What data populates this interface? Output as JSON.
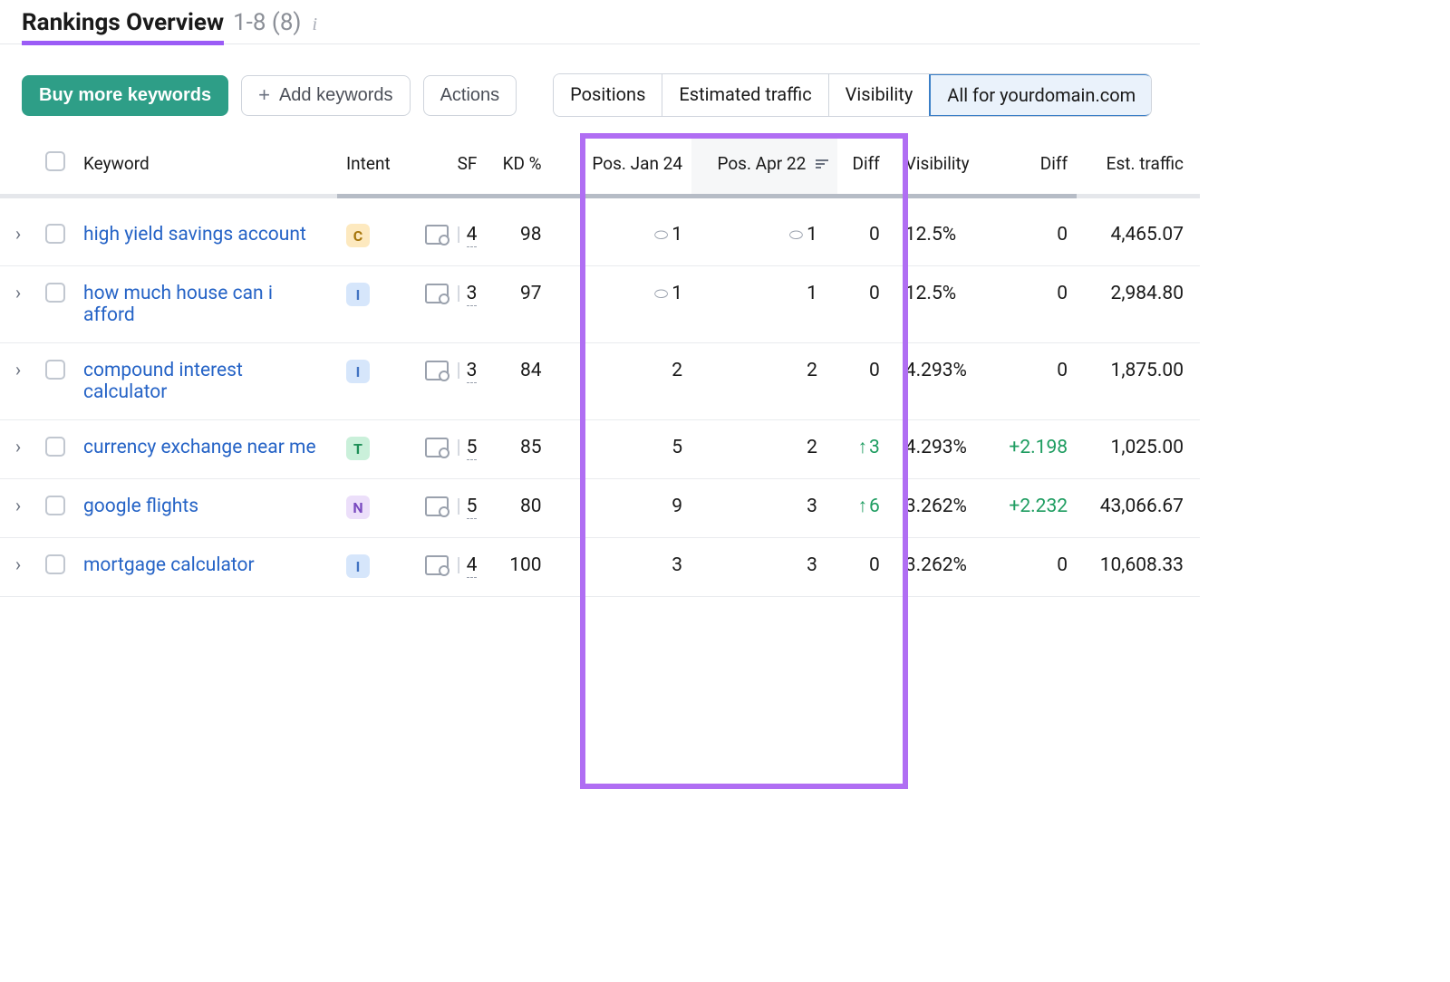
{
  "header": {
    "title": "Rankings Overview",
    "range": "1-8 (8)"
  },
  "toolbar": {
    "buy_label": "Buy more keywords",
    "add_label": "Add keywords",
    "actions_label": "Actions",
    "segs": [
      "Positions",
      "Estimated traffic",
      "Visibility",
      "All for yourdomain.com"
    ],
    "active_seg": 3
  },
  "columns": {
    "keyword": "Keyword",
    "intent": "Intent",
    "sf": "SF",
    "kd": "KD %",
    "pos1": "Pos. Jan 24",
    "pos2": "Pos. Apr 22",
    "diff1": "Diff",
    "visibility": "Visibility",
    "diff2": "Diff",
    "est": "Est. traffic"
  },
  "rows": [
    {
      "keyword": "high yield savings account",
      "intent": "C",
      "sf": "4",
      "kd": "98",
      "pos1": "1",
      "pos1_link": true,
      "pos2": "1",
      "pos2_link": true,
      "diff1": "0",
      "visibility": "12.5%",
      "diff2": "0",
      "est": "4,465.07"
    },
    {
      "keyword": "how much house can i afford",
      "intent": "I",
      "sf": "3",
      "kd": "97",
      "pos1": "1",
      "pos1_link": true,
      "pos2": "1",
      "pos2_link": false,
      "diff1": "0",
      "visibility": "12.5%",
      "diff2": "0",
      "est": "2,984.80"
    },
    {
      "keyword": "compound interest calculator",
      "intent": "I",
      "sf": "3",
      "kd": "84",
      "pos1": "2",
      "pos1_link": false,
      "pos2": "2",
      "pos2_link": false,
      "diff1": "0",
      "visibility": "4.293%",
      "diff2": "0",
      "est": "1,875.00"
    },
    {
      "keyword": "currency exchange near me",
      "intent": "T",
      "sf": "5",
      "kd": "85",
      "pos1": "5",
      "pos1_link": false,
      "pos2": "2",
      "pos2_link": false,
      "diff1": "3",
      "diff1_up": true,
      "visibility": "4.293%",
      "diff2": "+2.198",
      "diff2_plus": true,
      "est": "1,025.00"
    },
    {
      "keyword": "google flights",
      "intent": "N",
      "sf": "5",
      "kd": "80",
      "pos1": "9",
      "pos1_link": false,
      "pos2": "3",
      "pos2_link": false,
      "diff1": "6",
      "diff1_up": true,
      "visibility": "3.262%",
      "diff2": "+2.232",
      "diff2_plus": true,
      "est": "43,066.67"
    },
    {
      "keyword": "mortgage calculator",
      "intent": "I",
      "sf": "4",
      "kd": "100",
      "pos1": "3",
      "pos1_link": false,
      "pos2": "3",
      "pos2_link": false,
      "diff1": "0",
      "visibility": "3.262%",
      "diff2": "0",
      "est": "10,608.33"
    }
  ]
}
